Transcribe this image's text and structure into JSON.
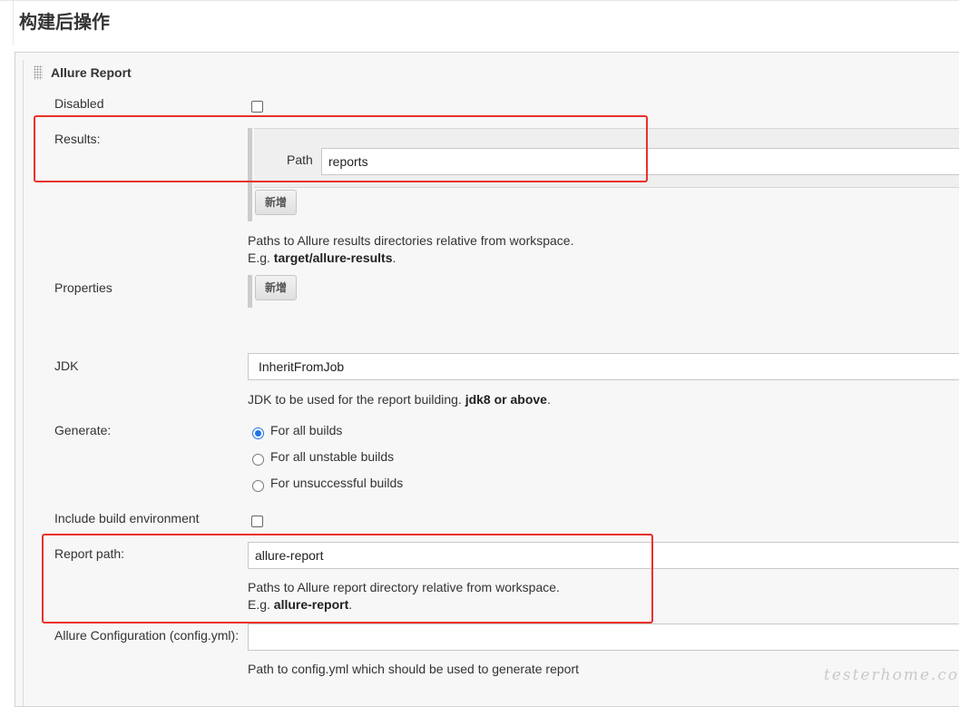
{
  "section": {
    "title": "构建后操作"
  },
  "plugin": {
    "title": "Allure Report"
  },
  "disabled": {
    "label": "Disabled",
    "checked": false
  },
  "results": {
    "label": "Results:",
    "path_label": "Path",
    "path_value": "reports",
    "add_button": "新增",
    "help_line1": "Paths to Allure results directories relative from workspace.",
    "help_eg_prefix": "E.g. ",
    "help_eg_value": "target/allure-results",
    "help_eg_suffix": "."
  },
  "properties": {
    "label": "Properties",
    "add_button": "新增"
  },
  "jdk": {
    "label": "JDK",
    "value": "InheritFromJob",
    "help_prefix": "JDK to be used for the report building. ",
    "help_bold": "jdk8 or above",
    "help_suffix": "."
  },
  "generate": {
    "label": "Generate:",
    "options": [
      "For all builds",
      "For all unstable builds",
      "For unsuccessful builds"
    ],
    "selected": "For all builds"
  },
  "include_env": {
    "label": "Include build environment",
    "checked": false
  },
  "report_path": {
    "label": "Report path:",
    "value": "allure-report",
    "help_line1": "Paths to Allure report directory relative from workspace.",
    "help_eg_prefix": "E.g. ",
    "help_eg_value": "allure-report",
    "help_eg_suffix": "."
  },
  "config": {
    "label": "Allure Configuration (config.yml):",
    "value": "",
    "help": "Path to config.yml which should be used to generate report"
  },
  "watermark": "testerhome.com",
  "colors": {
    "highlight": "#e8312a",
    "radio_accent": "#1e73e8",
    "panel_bg": "#f7f7f7"
  }
}
